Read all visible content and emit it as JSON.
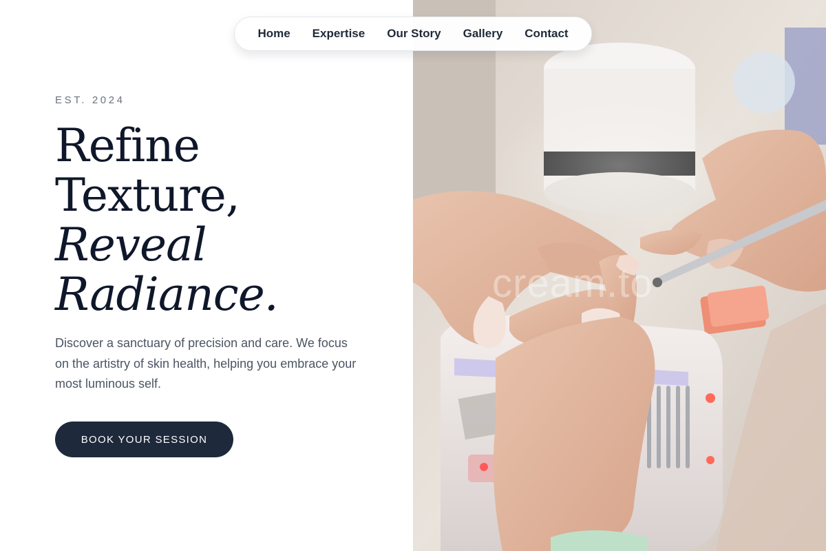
{
  "nav": {
    "items": [
      {
        "label": "Home"
      },
      {
        "label": "Expertise"
      },
      {
        "label": "Our Story"
      },
      {
        "label": "Gallery"
      },
      {
        "label": "Contact"
      }
    ]
  },
  "hero": {
    "eyebrow": "EST. 2024",
    "headline_line1": "Refine",
    "headline_line2": "Texture,",
    "headline_line3": "Reveal",
    "headline_line4": "Radiance.",
    "lead": "Discover a sanctuary of precision and care. We focus on the artistry of skin health, helping you embrace your most luminous self.",
    "cta_label": "BOOK YOUR SESSION"
  },
  "image": {
    "watermark": "cream.to",
    "subject": "manicure-in-progress-photo"
  },
  "colors": {
    "ink": "#0f172a",
    "button": "#1e293b",
    "muted_text": "#4b5563",
    "eyebrow": "#6b7280",
    "background": "#ffffff"
  }
}
